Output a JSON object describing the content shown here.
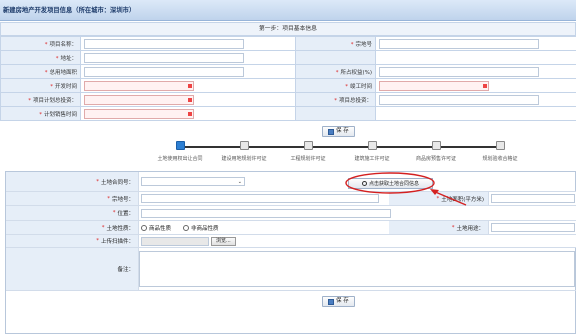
{
  "window": {
    "title": "新建房地产开发项目信息（所在城市：深圳市）"
  },
  "section1": {
    "header": "第一步：项目基本信息",
    "rows": [
      {
        "l1": "项目名称：",
        "r1": true,
        "l2": "宗地号",
        "r2": true
      },
      {
        "l1": "地址：",
        "r1": true
      },
      {
        "l1": "总用地面积",
        "r1": true,
        "l2": "所占权益(%)",
        "r2": true
      },
      {
        "l1": "开发时间",
        "r1": true,
        "d1": true,
        "l2": "竣工时间",
        "r2": true,
        "d2": true
      },
      {
        "l1": "项目计划总投资：",
        "r1": true,
        "d1": true,
        "l2": "项目总投资：",
        "r2": true
      },
      {
        "l1": "计划销售时间",
        "r1": true,
        "d1": true
      }
    ],
    "save_label": "保 存"
  },
  "steps": [
    {
      "label": "土地使用权出让合同",
      "active": true
    },
    {
      "label": "建设用地规划许可证",
      "active": false
    },
    {
      "label": "工程规划许可证",
      "active": false
    },
    {
      "label": "建筑施工许可证",
      "active": false
    },
    {
      "label": "商品房预售许可证",
      "active": false
    },
    {
      "label": "规划验收合格证",
      "active": false
    }
  ],
  "section2": {
    "contract_no_label": "土地合同号：",
    "get_contract_button": "点击获取土地合同信息",
    "parcel_no_label": "宗地号：",
    "land_area_label": "土地面积(平方米)",
    "location_label": "位置：",
    "land_nature_label": "土地性质：",
    "nature_options": [
      "商品性质",
      "非商品性质"
    ],
    "land_use_label": "土地用途：",
    "upload_label": "上传扫描件：",
    "browse_label": "浏览...",
    "remark_label": "备注：",
    "save_label": "保 存"
  },
  "colors": {
    "accent": "#2d7fd3",
    "annotation": "#d42020",
    "label_bg": "#e6eef8"
  }
}
